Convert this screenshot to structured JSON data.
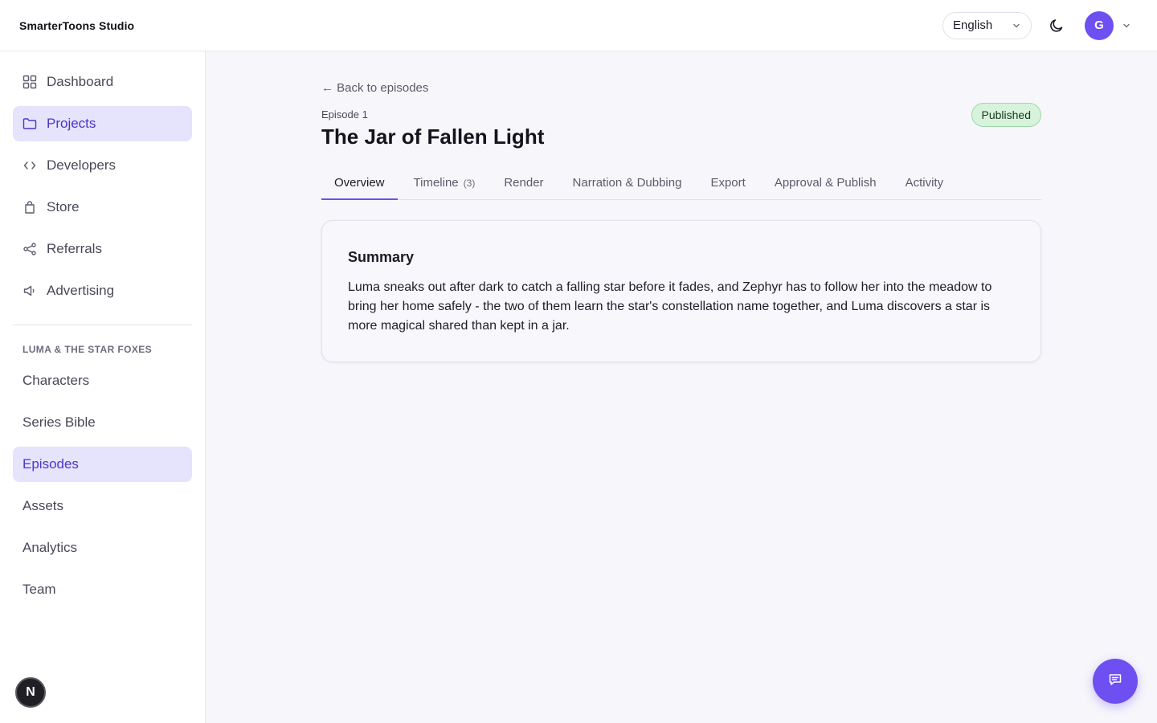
{
  "header": {
    "brand": "SmarterToons Studio",
    "language": "English",
    "avatar_initial": "G",
    "icons": {
      "language_chevron": "chevron-down-icon",
      "theme": "moon-icon",
      "avatar_chevron": "chevron-down-icon"
    }
  },
  "sidebar": {
    "items": [
      {
        "label": "Dashboard",
        "icon": "grid-icon"
      },
      {
        "label": "Projects",
        "icon": "folder-icon"
      },
      {
        "label": "Developers",
        "icon": "code-icon"
      },
      {
        "label": "Store",
        "icon": "bag-icon"
      },
      {
        "label": "Referrals",
        "icon": "share-icon"
      },
      {
        "label": "Advertising",
        "icon": "megaphone-icon"
      }
    ],
    "section_label": "LUMA & THE STAR FOXES",
    "section_items": [
      "Characters",
      "Series Bible",
      "Episodes",
      "Assets",
      "Analytics",
      "Team"
    ],
    "badge": "N"
  },
  "main": {
    "back_label": "← Back to episodes",
    "episode_label": "Episode 1",
    "title": "The Jar of Fallen Light",
    "status": "Published",
    "tabs": [
      {
        "label": "Overview",
        "count": ""
      },
      {
        "label": "Timeline",
        "count": "(3)"
      },
      {
        "label": "Render",
        "count": ""
      },
      {
        "label": "Narration & Dubbing",
        "count": ""
      },
      {
        "label": "Export",
        "count": ""
      },
      {
        "label": "Approval & Publish",
        "count": ""
      },
      {
        "label": "Activity",
        "count": ""
      }
    ],
    "summary": {
      "title": "Summary",
      "body": "Luma sneaks out after dark to catch a falling star before it fades, and Zephyr has to follow her into the meadow to bring her home safely - the two of them learn the star's constellation name together, and Luma discovers a star is more magical shared than kept in a jar."
    }
  },
  "colors": {
    "accent": "#6d4ff2",
    "active_bg": "#e6e3fd",
    "published_bg": "#d8f3dc"
  }
}
